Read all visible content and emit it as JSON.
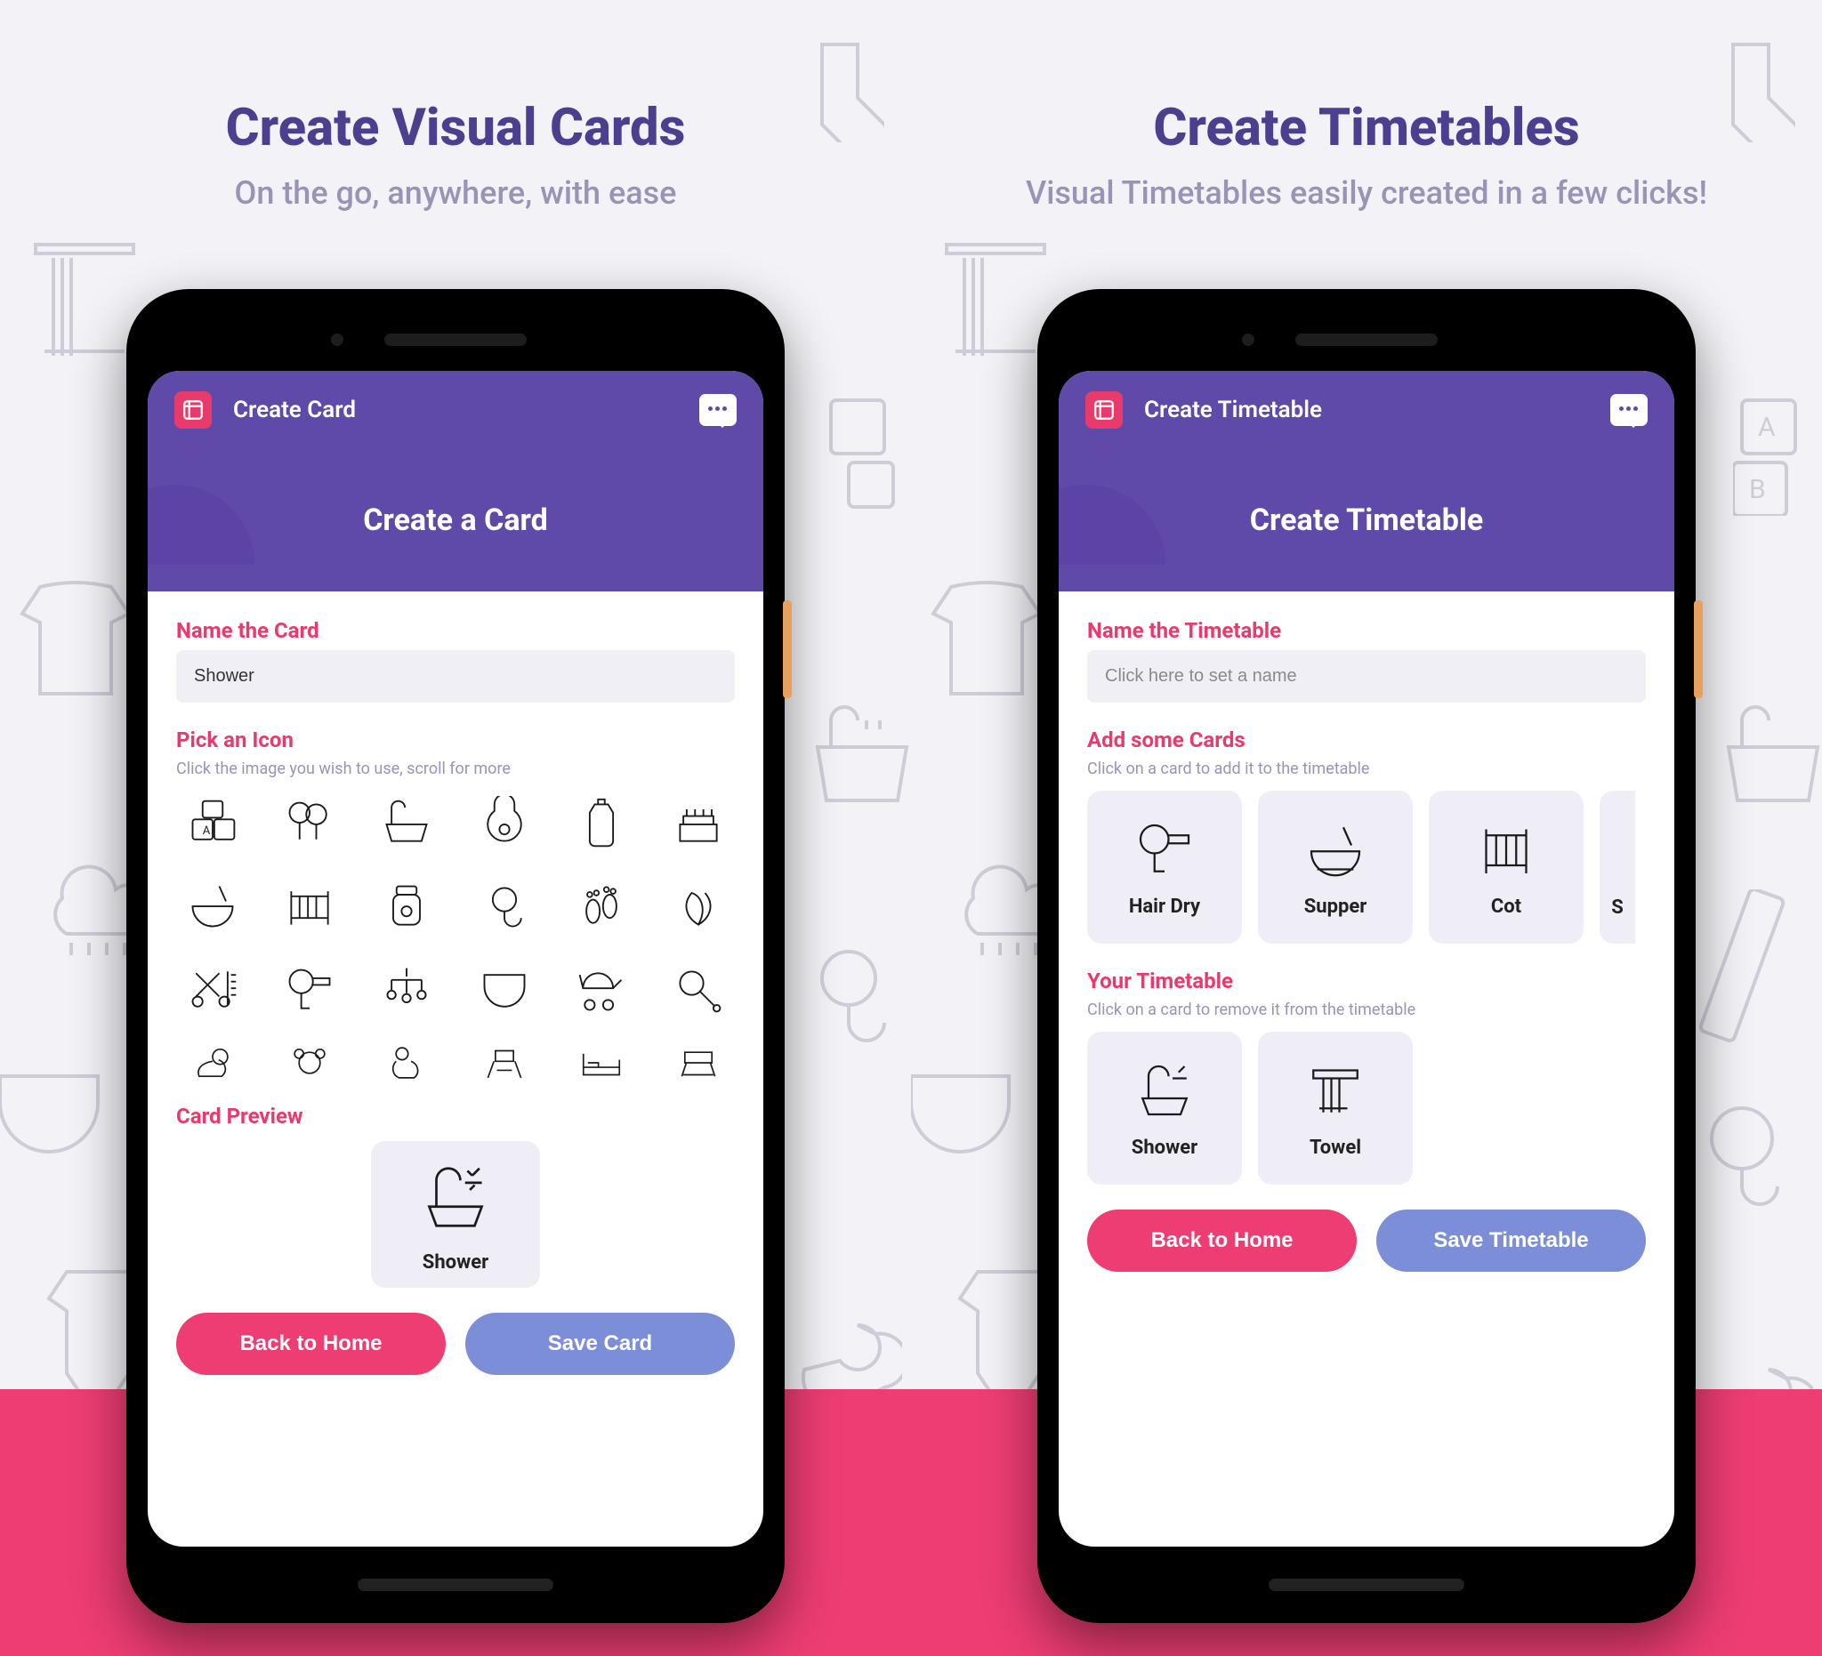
{
  "left": {
    "headline": "Create Visual Cards",
    "subhead": "On the go, anywhere, with ease",
    "appbar_title": "Create Card",
    "hero_title": "Create a Card",
    "section_name_label": "Name the Card",
    "name_value": "Shower",
    "section_icon_label": "Pick an Icon",
    "icon_hint": "Click the image you wish to use, scroll for more",
    "icons_row1": [
      "blocks-icon",
      "balloons-icon",
      "bathtub-icon",
      "bib-icon",
      "bottle-icon",
      "birthday-cake-icon"
    ],
    "icons_row2": [
      "bowl-icon",
      "cot-icon",
      "jar-icon",
      "pacifier-icon",
      "footprints-icon",
      "leaves-icon"
    ],
    "icons_row3": [
      "comb-scissors-icon",
      "hairdryer-icon",
      "mobile-toy-icon",
      "diaper-icon",
      "stroller-icon",
      "rattle-icon"
    ],
    "icons_row4": [
      "duck-icon",
      "teddy-icon",
      "nursing-icon",
      "highchair-icon",
      "bed-icon",
      "walker-icon"
    ],
    "section_preview_label": "Card Preview",
    "preview_card_label": "Shower",
    "btn_back": "Back to Home",
    "btn_save": "Save Card"
  },
  "right": {
    "headline": "Create Timetables",
    "subhead": "Visual Timetables easily created in a few clicks!",
    "appbar_title": "Create Timetable",
    "hero_title": "Create Timetable",
    "section_name_label": "Name the Timetable",
    "name_placeholder": "Click here to set a name",
    "section_add_label": "Add some Cards",
    "add_hint": "Click on a card to add it to the timetable",
    "add_cards": [
      {
        "label": "Hair Dry",
        "icon": "hairdryer-icon"
      },
      {
        "label": "Supper",
        "icon": "bowl-icon"
      },
      {
        "label": "Cot",
        "icon": "cot-icon"
      },
      {
        "label": "S",
        "icon": "partial-icon"
      }
    ],
    "section_your_label": "Your Timetable",
    "your_hint": "Click on a card to remove it from the timetable",
    "your_cards": [
      {
        "label": "Shower",
        "icon": "shower-icon"
      },
      {
        "label": "Towel",
        "icon": "towel-icon"
      }
    ],
    "btn_back": "Back to Home",
    "btn_save": "Save Timetable"
  },
  "colors": {
    "purple": "#5f4aa9",
    "pink": "#ee3d73",
    "blue_btn": "#7d8ed9",
    "text_purple": "#4d3f8f"
  }
}
